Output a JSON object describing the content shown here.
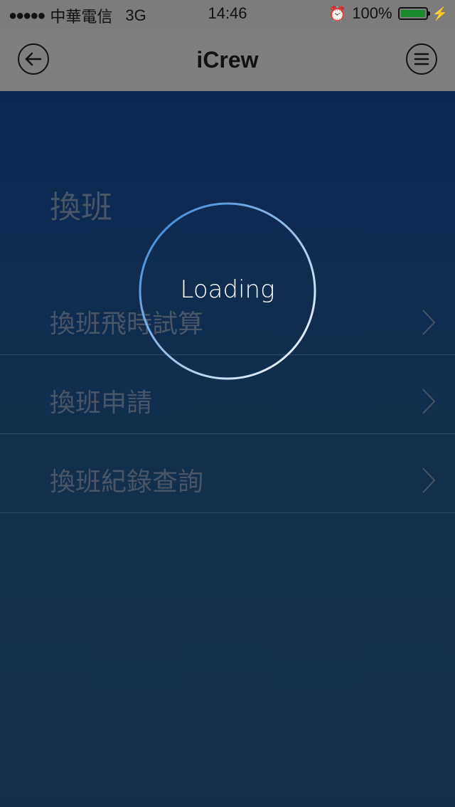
{
  "status_bar": {
    "signal": "●●●●●",
    "carrier": "中華電信",
    "network": "3G",
    "time": "14:46",
    "alarm_icon": "alarm-clock-icon",
    "battery_percent": "100%",
    "battery_level": 1.0,
    "battery_color": "#1b8a2d"
  },
  "nav": {
    "title": "iCrew",
    "back_icon": "back-arrow-icon",
    "menu_icon": "hamburger-menu-icon"
  },
  "section": {
    "title": "換班"
  },
  "menu": {
    "items": [
      {
        "label": "換班飛時試算",
        "icon": "chevron-right-icon"
      },
      {
        "label": "換班申請",
        "icon": "chevron-right-icon"
      },
      {
        "label": "換班紀錄查詢",
        "icon": "chevron-right-icon"
      }
    ]
  },
  "loading": {
    "text": "Loading",
    "ring_color_start": "#2b7fd8",
    "ring_color_end": "#ffffff"
  }
}
